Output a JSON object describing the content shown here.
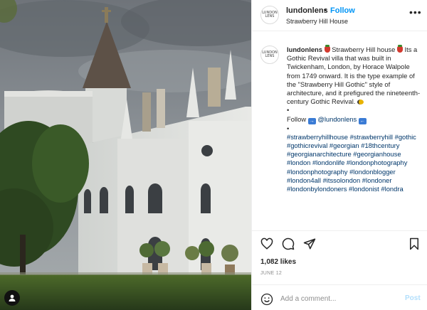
{
  "post_image": {
    "subject": "Strawberry Hill house photograph",
    "colors": {
      "sky": "#7d8288",
      "castle": "#d9dbd9",
      "lawn": "#3a5a1e",
      "tree": "#2f4a22"
    }
  },
  "header": {
    "avatar_text": "LUNDON\nLENS",
    "username": "lundonlens",
    "separator": "•",
    "follow_label": "Follow",
    "location": "Strawberry Hill House",
    "more_icon": "more-horizontal-icon"
  },
  "caption": {
    "username": "lundonlens",
    "line1": "Strawberry Hill house",
    "body": "Its a Gothic Revival villa that was built in Twickenham, London, by Horace Walpole from 1749 onward. It is the type example of the \"Strawberry Hill Gothic\" style of architecture, and it prefigured the nineteenth-century Gothic Revival.",
    "bullet": "•",
    "follow_text": "Follow",
    "handle": "@lundonlens",
    "hashtags": "#strawberryhillhouse #strawberryhill #gothic #gothicrevival #georgian #18thcentury #georgianarchitecture #georgianhouse #london #londonlife #londonphotography #londonphotography #londonblogger #london4all #itssolondon #londoner #londonbylondoners #londonist #londra"
  },
  "actions": {
    "like_icon": "heart-icon",
    "comment_icon": "comment-bubble-icon",
    "share_icon": "paper-plane-icon",
    "save_icon": "bookmark-icon"
  },
  "likes": "1,082 likes",
  "date": "JUNE 12",
  "comment": {
    "placeholder": "Add a comment...",
    "post_label": "Post",
    "emoji_icon": "smiley-icon"
  },
  "accent": {
    "link": "#0095f6",
    "hashtag": "#00376b",
    "muted": "#8e8e8e"
  }
}
